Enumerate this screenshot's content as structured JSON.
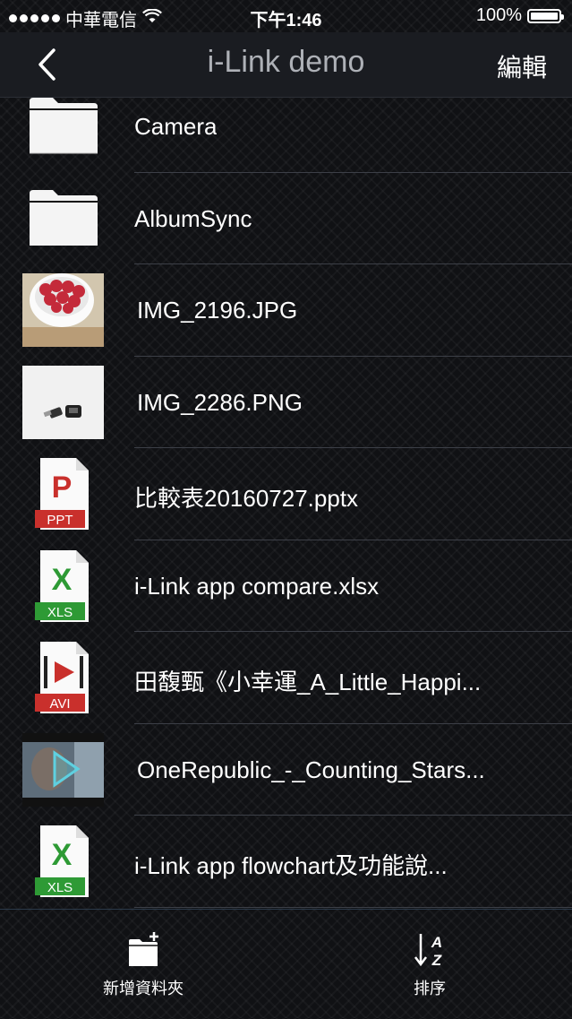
{
  "status_bar": {
    "carrier": "中華電信",
    "time": "下午1:46",
    "battery": "100%"
  },
  "nav": {
    "title": "i-Link demo",
    "edit_label": "編輯"
  },
  "files": [
    {
      "name": "Camera",
      "icon": "folder-icon"
    },
    {
      "name": "AlbumSync",
      "icon": "folder-icon"
    },
    {
      "name": "IMG_2196.JPG",
      "icon": "image-thumbnail"
    },
    {
      "name": "IMG_2286.PNG",
      "icon": "image-thumbnail"
    },
    {
      "name": "比較表20160727.pptx",
      "icon": "ppt-file-icon",
      "badge": "PPT"
    },
    {
      "name": "i-Link app compare.xlsx",
      "icon": "xls-file-icon",
      "badge": "XLS"
    },
    {
      "name": "田馥甄《小幸運_A_Little_Happi...",
      "icon": "avi-file-icon",
      "badge": "AVI"
    },
    {
      "name": "OneRepublic_-_Counting_Stars...",
      "icon": "video-thumbnail"
    },
    {
      "name": "i-Link app flowchart及功能說...",
      "icon": "xls-file-icon",
      "badge": "XLS"
    }
  ],
  "toolbar": {
    "new_folder_label": "新增資料夾",
    "sort_label": "排序"
  },
  "colors": {
    "ppt": "#c9302c",
    "xls": "#2e9a35",
    "avi": "#c9302c",
    "background": "#101114"
  }
}
